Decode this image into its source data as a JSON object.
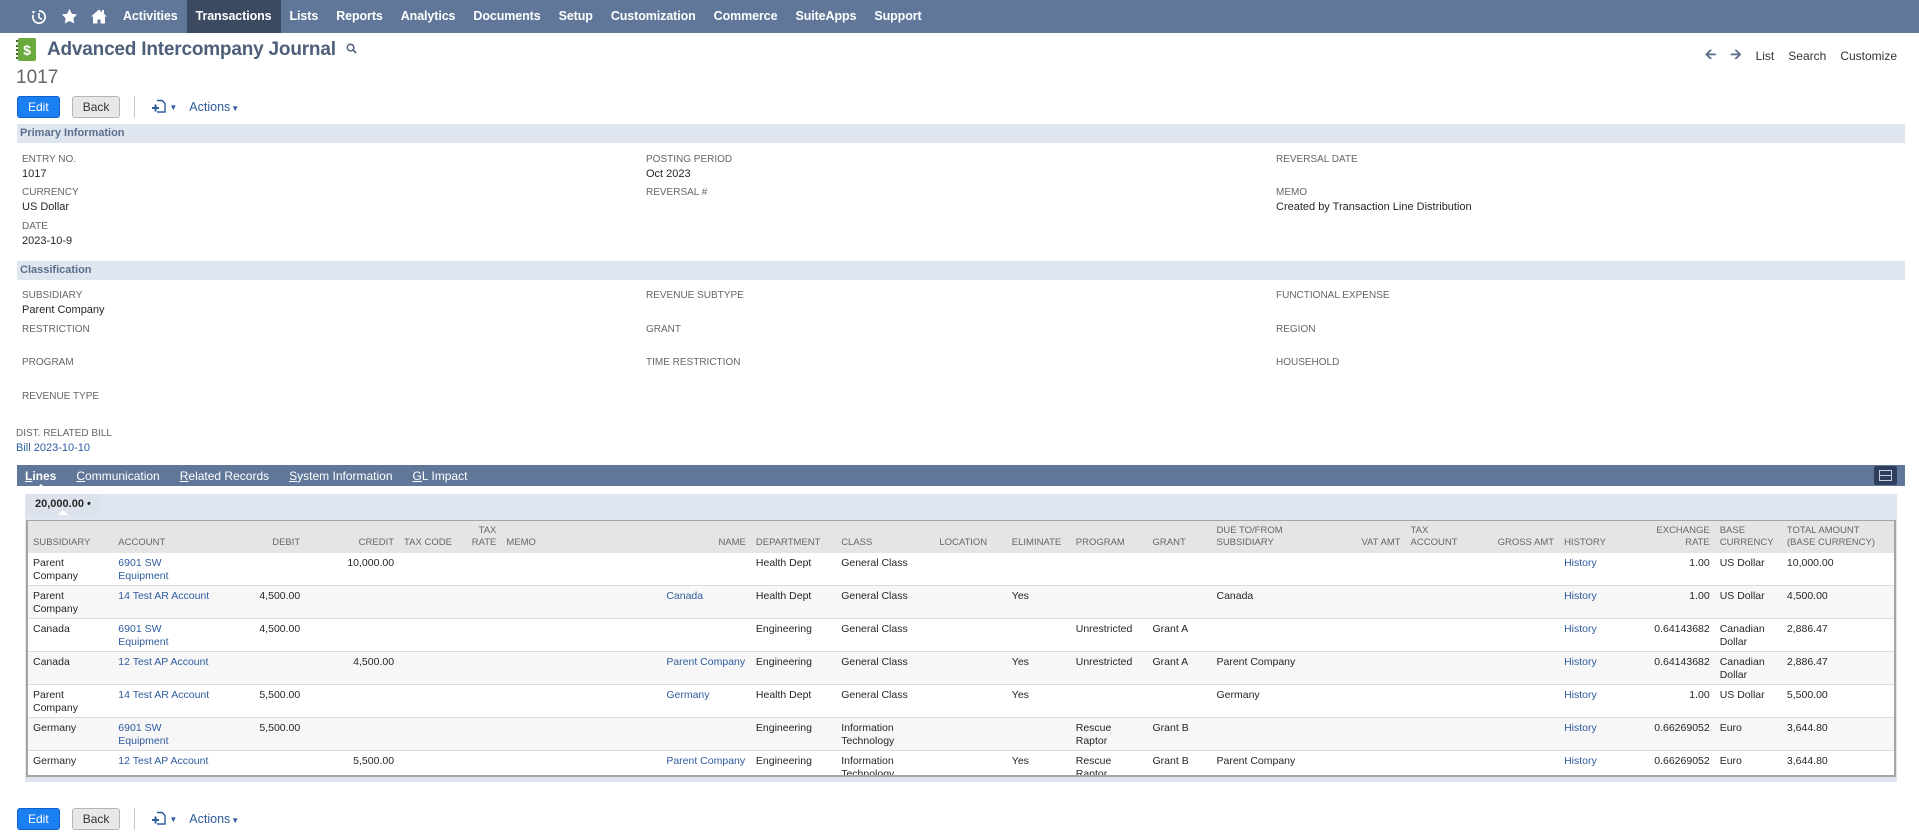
{
  "nav": {
    "icons": [
      "recent-records-icon",
      "favorites-star-icon",
      "home-icon"
    ],
    "items": [
      "Activities",
      "Transactions",
      "Lists",
      "Reports",
      "Analytics",
      "Documents",
      "Setup",
      "Customization",
      "Commerce",
      "SuiteApps",
      "Support"
    ],
    "active": "Transactions"
  },
  "header": {
    "title": "Advanced Intercompany Journal",
    "record_number": "1017",
    "right_links": {
      "list": "List",
      "search": "Search",
      "customize": "Customize"
    }
  },
  "buttons": {
    "edit": "Edit",
    "back": "Back",
    "actions": "Actions"
  },
  "primary": {
    "section_title": "Primary Information",
    "entry_no": {
      "label": "Entry No.",
      "value": "1017"
    },
    "currency": {
      "label": "Currency",
      "value": "US Dollar"
    },
    "date": {
      "label": "Date",
      "value": "2023-10-9"
    },
    "posting_period": {
      "label": "Posting Period",
      "value": "Oct 2023"
    },
    "reversal_no": {
      "label": "Reversal #",
      "value": ""
    },
    "reversal_date": {
      "label": "Reversal Date",
      "value": ""
    },
    "memo": {
      "label": "Memo",
      "value": "Created by Transaction Line Distribution"
    }
  },
  "classification": {
    "section_title": "Classification",
    "subsidiary": {
      "label": "Subsidiary",
      "value": "Parent Company"
    },
    "restriction": {
      "label": "Restriction",
      "value": ""
    },
    "program": {
      "label": "Program",
      "value": ""
    },
    "revenue_type": {
      "label": "Revenue Type",
      "value": ""
    },
    "revenue_subtype": {
      "label": "Revenue Subtype",
      "value": ""
    },
    "grant": {
      "label": "Grant",
      "value": ""
    },
    "time_restriction": {
      "label": "Time Restriction",
      "value": ""
    },
    "functional_expense": {
      "label": "Functional Expense",
      "value": ""
    },
    "region": {
      "label": "Region",
      "value": ""
    },
    "household": {
      "label": "Household",
      "value": ""
    }
  },
  "dist_related_bill": {
    "label": "Dist. Related Bill",
    "value": "Bill 2023-10-10"
  },
  "tabs": [
    {
      "label": "Lines",
      "key": "L",
      "rest": "ines",
      "active": true
    },
    {
      "label": "Communication",
      "key": "C",
      "rest": "ommunication"
    },
    {
      "label": "Related Records",
      "key": "R",
      "rest": "elated Records"
    },
    {
      "label": "System Information",
      "key": "S",
      "rest": "ystem Information"
    },
    {
      "label": "GL Impact",
      "key": "G",
      "rest": "L Impact"
    }
  ],
  "lines": {
    "subtab_label": "20,000.00 •",
    "columns": [
      "Subsidiary",
      "Account",
      "Debit",
      "Credit",
      "Tax Code",
      "Tax Rate",
      "Memo",
      "Name",
      "Department",
      "Class",
      "Location",
      "Eliminate",
      "Program",
      "Grant",
      "Due To/From Subsidiary",
      "VAT Amt",
      "Tax Account",
      "Gross Amt",
      "History",
      "Exchange Rate",
      "Base Currency",
      "Total Amount (Base Currency)"
    ],
    "rows": [
      {
        "subsidiary": "Parent Company",
        "account": "6901 SW Equipment",
        "debit": "",
        "credit": "10,000.00",
        "tax_code": "",
        "tax_rate": "",
        "memo": "",
        "name": "",
        "department": "Health Dept",
        "class": "General Class",
        "location": "",
        "eliminate": "",
        "program": "",
        "grant": "",
        "due_to_from": "",
        "vat_amt": "",
        "tax_account": "",
        "gross_amt": "",
        "history": "History",
        "exchange_rate": "1.00",
        "base_currency": "US Dollar",
        "total_amount": "10,000.00"
      },
      {
        "subsidiary": "Parent Company",
        "account": "14 Test AR Account",
        "debit": "4,500.00",
        "credit": "",
        "tax_code": "",
        "tax_rate": "",
        "memo": "",
        "name": "Canada",
        "department": "Health Dept",
        "class": "General Class",
        "location": "",
        "eliminate": "Yes",
        "program": "",
        "grant": "",
        "due_to_from": "Canada",
        "vat_amt": "",
        "tax_account": "",
        "gross_amt": "",
        "history": "History",
        "exchange_rate": "1.00",
        "base_currency": "US Dollar",
        "total_amount": "4,500.00"
      },
      {
        "subsidiary": "Canada",
        "account": "6901 SW Equipment",
        "debit": "4,500.00",
        "credit": "",
        "tax_code": "",
        "tax_rate": "",
        "memo": "",
        "name": "",
        "department": "Engineering",
        "class": "General Class",
        "location": "",
        "eliminate": "",
        "program": "Unrestricted",
        "grant": "Grant A",
        "due_to_from": "",
        "vat_amt": "",
        "tax_account": "",
        "gross_amt": "",
        "history": "History",
        "exchange_rate": "0.64143682",
        "base_currency": "Canadian Dollar",
        "total_amount": "2,886.47"
      },
      {
        "subsidiary": "Canada",
        "account": "12 Test AP Account",
        "debit": "",
        "credit": "4,500.00",
        "tax_code": "",
        "tax_rate": "",
        "memo": "",
        "name": "Parent Company",
        "department": "Engineering",
        "class": "General Class",
        "location": "",
        "eliminate": "Yes",
        "program": "Unrestricted",
        "grant": "Grant A",
        "due_to_from": "Parent Company",
        "vat_amt": "",
        "tax_account": "",
        "gross_amt": "",
        "history": "History",
        "exchange_rate": "0.64143682",
        "base_currency": "Canadian Dollar",
        "total_amount": "2,886.47"
      },
      {
        "subsidiary": "Parent Company",
        "account": "14 Test AR Account",
        "debit": "5,500.00",
        "credit": "",
        "tax_code": "",
        "tax_rate": "",
        "memo": "",
        "name": "Germany",
        "department": "Health Dept",
        "class": "General Class",
        "location": "",
        "eliminate": "Yes",
        "program": "",
        "grant": "",
        "due_to_from": "Germany",
        "vat_amt": "",
        "tax_account": "",
        "gross_amt": "",
        "history": "History",
        "exchange_rate": "1.00",
        "base_currency": "US Dollar",
        "total_amount": "5,500.00"
      },
      {
        "subsidiary": "Germany",
        "account": "6901 SW Equipment",
        "debit": "5,500.00",
        "credit": "",
        "tax_code": "",
        "tax_rate": "",
        "memo": "",
        "name": "",
        "department": "Engineering",
        "class": "Information Technology",
        "location": "",
        "eliminate": "",
        "program": "Rescue Raptor",
        "grant": "Grant B",
        "due_to_from": "",
        "vat_amt": "",
        "tax_account": "",
        "gross_amt": "",
        "history": "History",
        "exchange_rate": "0.66269052",
        "base_currency": "Euro",
        "total_amount": "3,644.80"
      },
      {
        "subsidiary": "Germany",
        "account": "12 Test AP Account",
        "debit": "",
        "credit": "5,500.00",
        "tax_code": "",
        "tax_rate": "",
        "memo": "",
        "name": "Parent Company",
        "department": "Engineering",
        "class": "Information Technology",
        "location": "",
        "eliminate": "Yes",
        "program": "Rescue Raptor",
        "grant": "Grant B",
        "due_to_from": "Parent Company",
        "vat_amt": "",
        "tax_account": "",
        "gross_amt": "",
        "history": "History",
        "exchange_rate": "0.66269052",
        "base_currency": "Euro",
        "total_amount": "3,644.80"
      }
    ]
  }
}
